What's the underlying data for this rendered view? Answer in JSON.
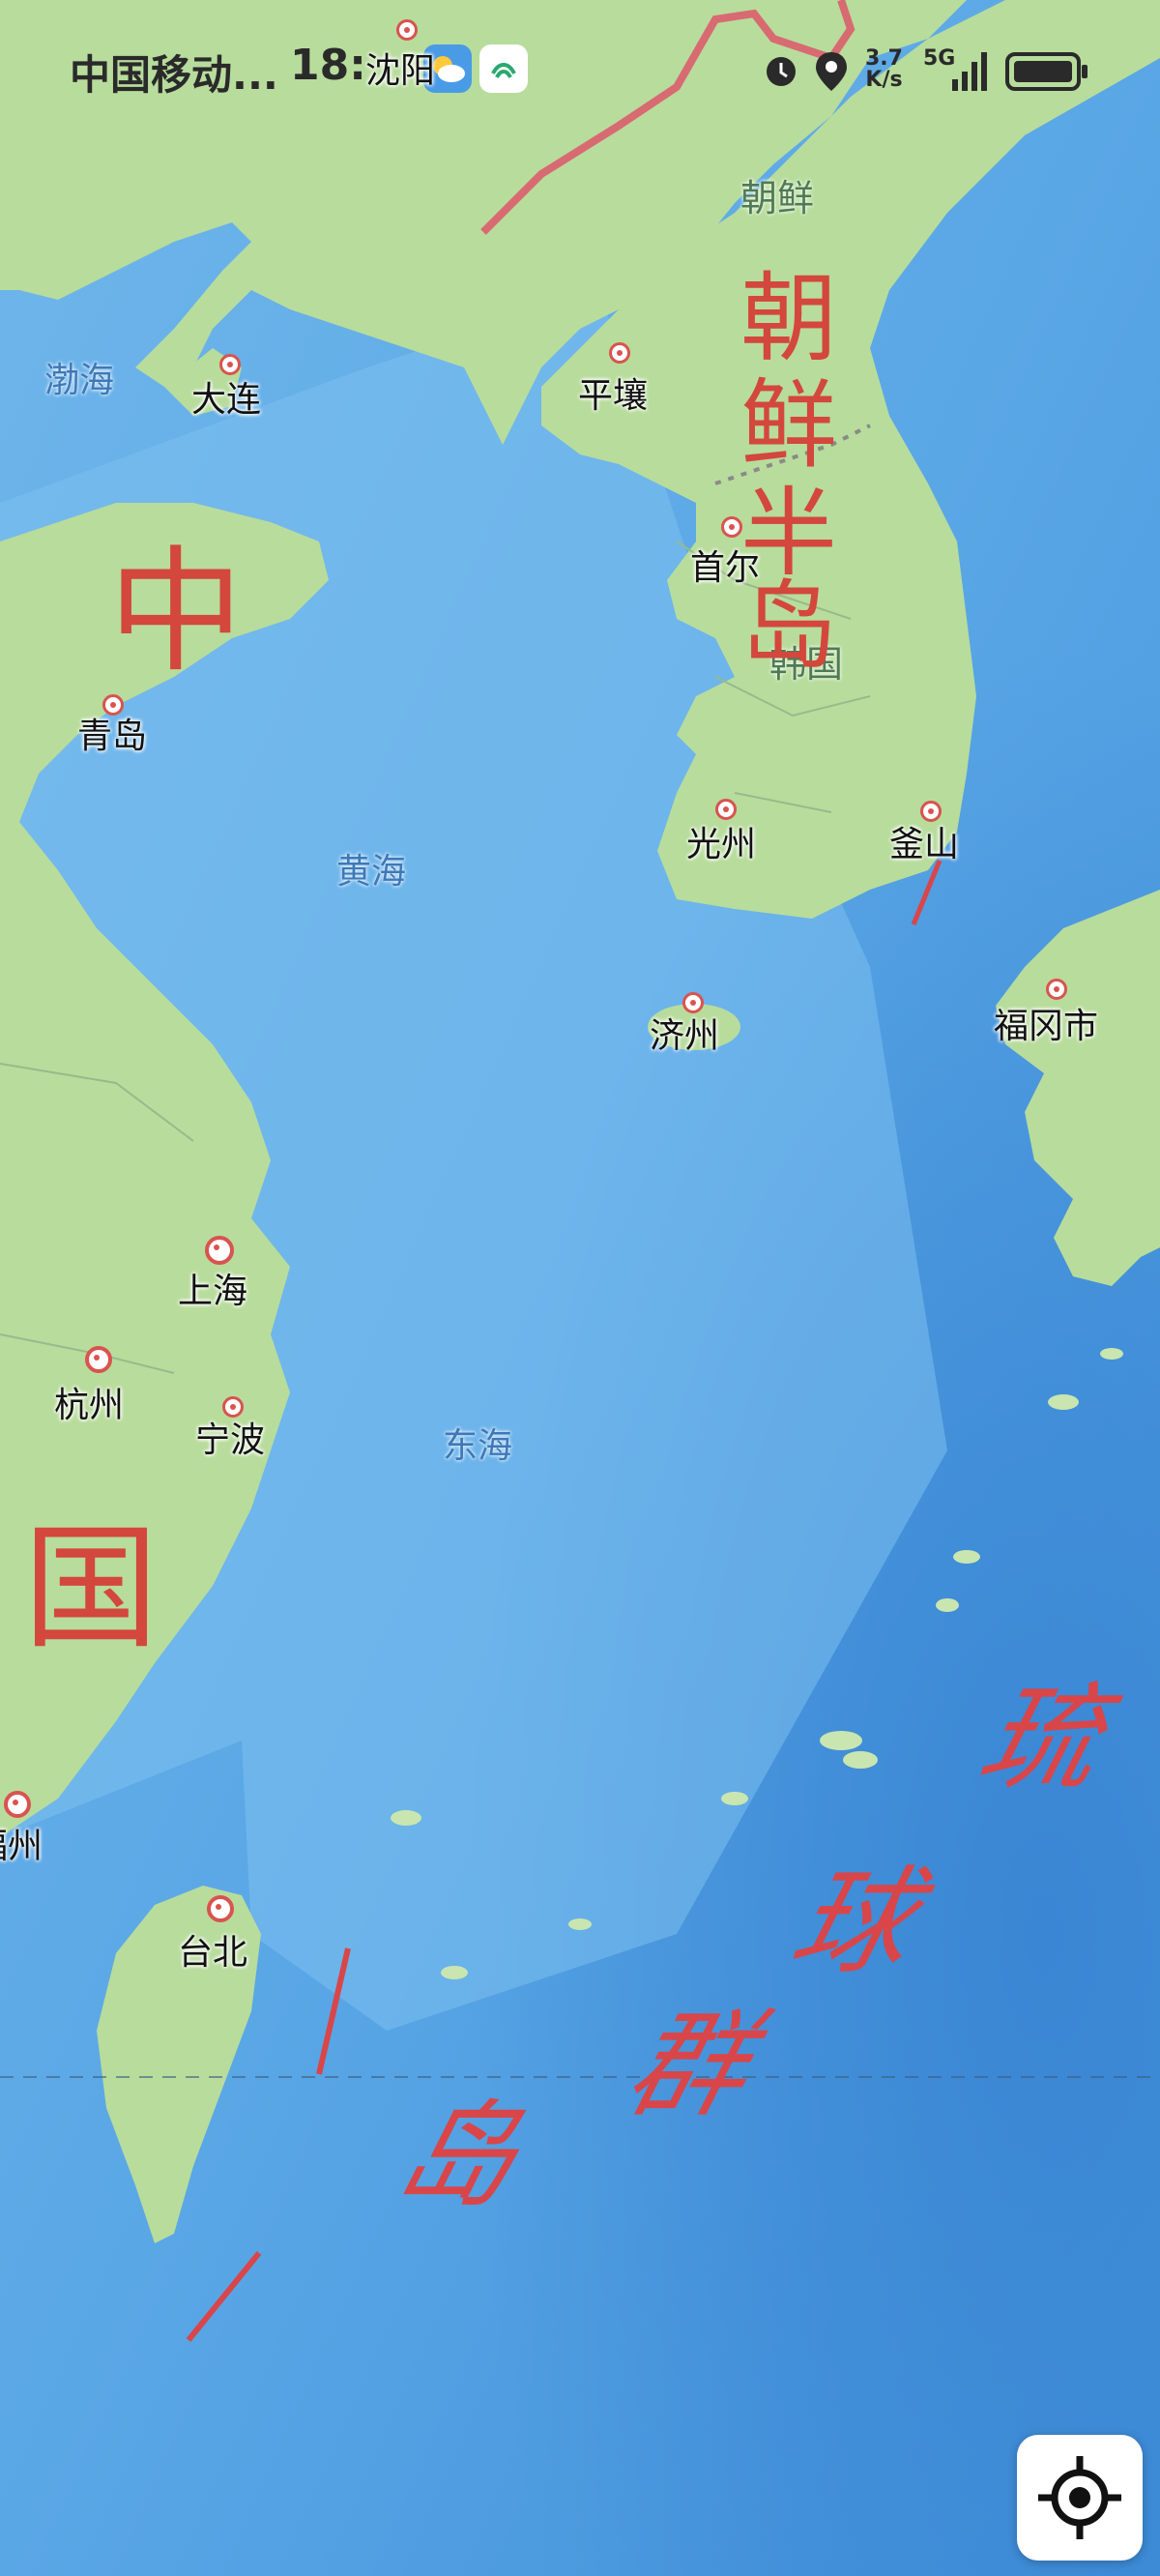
{
  "status_bar": {
    "carrier": "中国移动...",
    "time": "18:",
    "net_speed_value": "3.7",
    "net_speed_unit": "K/s",
    "network_type": "5G"
  },
  "places": {
    "shenyang": "沈阳",
    "dalian": "大连",
    "qingdao": "青岛",
    "pyongyang": "平壤",
    "seoul": "首尔",
    "gwangju": "光州",
    "busan": "釜山",
    "jeju": "济州",
    "fukuoka": "福冈市",
    "shanghai": "上海",
    "hangzhou": "杭州",
    "ningbo": "宁波",
    "fuzhou": "福州",
    "taipei": "台北"
  },
  "seas": {
    "bohai": "渤海",
    "yellow_sea": "黄海",
    "east_sea": "东海"
  },
  "countries": {
    "north_korea": "朝鲜",
    "south_korea": "韩国"
  },
  "annotations": {
    "china": [
      "中",
      "国"
    ],
    "korean_peninsula": [
      "朝",
      "鲜",
      "半",
      "岛"
    ],
    "ryukyu": [
      "琉",
      "球",
      "群",
      "岛"
    ]
  },
  "colors": {
    "ocean": "#5aa7e6",
    "land": "#b8dc9c",
    "annotation": "#d3473d",
    "border": "#d86a72"
  },
  "icons": [
    "weather-icon",
    "sim-icon",
    "alarm-icon",
    "location-icon",
    "signal-icon",
    "battery-icon",
    "locate-icon"
  ]
}
